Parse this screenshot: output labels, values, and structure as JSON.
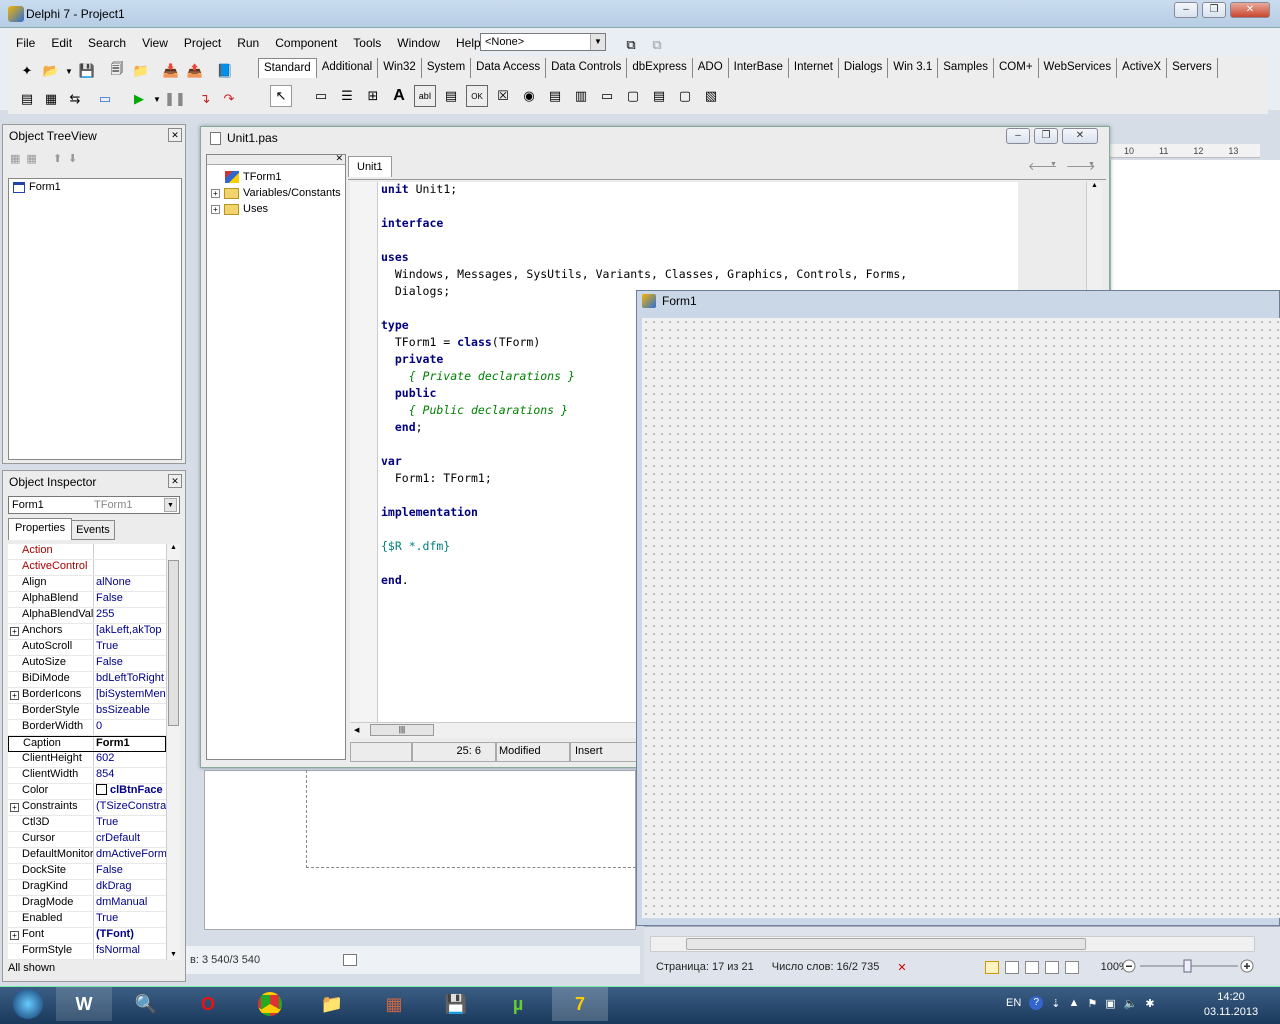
{
  "main": {
    "title": "Delphi 7 - Project1",
    "menu": [
      "File",
      "Edit",
      "Search",
      "View",
      "Project",
      "Run",
      "Component",
      "Tools",
      "Window",
      "Help"
    ],
    "config_combo": "<None>",
    "palette_tabs": [
      "Standard",
      "Additional",
      "Win32",
      "System",
      "Data Access",
      "Data Controls",
      "dbExpress",
      "ADO",
      "InterBase",
      "Internet",
      "Dialogs",
      "Win 3.1",
      "Samples",
      "COM+",
      "WebServices",
      "ActiveX",
      "Servers"
    ]
  },
  "tree_view": {
    "title": "Object TreeView",
    "items": [
      "Form1"
    ]
  },
  "inspector": {
    "title": "Object Inspector",
    "selected_object": "Form1",
    "selected_type": "TForm1",
    "tabs": [
      "Properties",
      "Events"
    ],
    "properties": [
      {
        "name": "Action",
        "value": "",
        "expandable": false,
        "red": true
      },
      {
        "name": "ActiveControl",
        "value": "",
        "expandable": false,
        "red": true
      },
      {
        "name": "Align",
        "value": "alNone",
        "expandable": false
      },
      {
        "name": "AlphaBlend",
        "value": "False",
        "expandable": false
      },
      {
        "name": "AlphaBlendValu",
        "value": "255",
        "expandable": false
      },
      {
        "name": "Anchors",
        "value": "[akLeft,akTop",
        "expandable": true
      },
      {
        "name": "AutoScroll",
        "value": "True",
        "expandable": false
      },
      {
        "name": "AutoSize",
        "value": "False",
        "expandable": false
      },
      {
        "name": "BiDiMode",
        "value": "bdLeftToRight",
        "expandable": false
      },
      {
        "name": "BorderIcons",
        "value": "[biSystemMen",
        "expandable": true
      },
      {
        "name": "BorderStyle",
        "value": "bsSizeable",
        "expandable": false
      },
      {
        "name": "BorderWidth",
        "value": "0",
        "expandable": false
      },
      {
        "name": "Caption",
        "value": "Form1",
        "expandable": false,
        "selected": true
      },
      {
        "name": "ClientHeight",
        "value": "602",
        "expandable": false
      },
      {
        "name": "ClientWidth",
        "value": "854",
        "expandable": false
      },
      {
        "name": "Color",
        "value": "clBtnFace",
        "expandable": false,
        "swatch": true
      },
      {
        "name": "Constraints",
        "value": "(TSizeConstra",
        "expandable": true
      },
      {
        "name": "Ctl3D",
        "value": "True",
        "expandable": false
      },
      {
        "name": "Cursor",
        "value": "crDefault",
        "expandable": false
      },
      {
        "name": "DefaultMonitor",
        "value": "dmActiveForm",
        "expandable": false
      },
      {
        "name": "DockSite",
        "value": "False",
        "expandable": false
      },
      {
        "name": "DragKind",
        "value": "dkDrag",
        "expandable": false
      },
      {
        "name": "DragMode",
        "value": "dmManual",
        "expandable": false
      },
      {
        "name": "Enabled",
        "value": "True",
        "expandable": false
      },
      {
        "name": "Font",
        "value": "(TFont)",
        "expandable": true,
        "bold": true
      },
      {
        "name": "FormStyle",
        "value": "fsNormal",
        "expandable": false
      }
    ],
    "footer": "All shown"
  },
  "editor": {
    "title": "Unit1.pas",
    "tab": "Unit1",
    "explorer": [
      {
        "label": "TForm1",
        "expand": false
      },
      {
        "label": "Variables/Constants",
        "expand": true
      },
      {
        "label": "Uses",
        "expand": true
      }
    ],
    "code": [
      [
        {
          "t": "unit",
          "c": "kw"
        },
        {
          "t": " Unit1;",
          "c": ""
        }
      ],
      [],
      [
        {
          "t": "interface",
          "c": "kw"
        }
      ],
      [],
      [
        {
          "t": "uses",
          "c": "kw"
        }
      ],
      [
        {
          "t": "  Windows, Messages, SysUtils, Variants, Classes, Graphics, Controls, Forms,",
          "c": ""
        }
      ],
      [
        {
          "t": "  Dialogs;",
          "c": ""
        }
      ],
      [],
      [
        {
          "t": "type",
          "c": "kw"
        }
      ],
      [
        {
          "t": "  TForm1 = ",
          "c": ""
        },
        {
          "t": "class",
          "c": "kw"
        },
        {
          "t": "(TForm)",
          "c": ""
        }
      ],
      [
        {
          "t": "  ",
          "c": ""
        },
        {
          "t": "private",
          "c": "kw"
        }
      ],
      [
        {
          "t": "    { Private declarations }",
          "c": "cm"
        }
      ],
      [
        {
          "t": "  ",
          "c": ""
        },
        {
          "t": "public",
          "c": "kw"
        }
      ],
      [
        {
          "t": "    { Public declarations }",
          "c": "cm"
        }
      ],
      [
        {
          "t": "  ",
          "c": ""
        },
        {
          "t": "end",
          "c": "kw"
        },
        {
          "t": ";",
          "c": ""
        }
      ],
      [],
      [
        {
          "t": "var",
          "c": "kw"
        }
      ],
      [
        {
          "t": "  Form1: TForm1;",
          "c": ""
        }
      ],
      [],
      [
        {
          "t": "implementation",
          "c": "kw"
        }
      ],
      [],
      [
        {
          "t": "{$R *.dfm}",
          "c": "dr"
        }
      ],
      [],
      [
        {
          "t": "end",
          "c": "kw"
        },
        {
          "t": ".",
          "c": ""
        }
      ]
    ],
    "status": {
      "position": "25:  6",
      "state": "Modified",
      "mode": "Insert"
    }
  },
  "form": {
    "title": "Form1"
  },
  "word": {
    "status_left": "в: 3 540/3 540",
    "page": "Страница: 17 из 21",
    "words": "Число слов: 16/2 735",
    "zoom": "100%",
    "ruler": [
      "10",
      "11",
      "12",
      "13"
    ]
  },
  "taskbar": {
    "lang": "EN",
    "time": "14:20",
    "date": "03.11.2013"
  },
  "colors": {
    "keyword": "#000080",
    "comment": "#008000",
    "directive": "#008080",
    "property_value": "#00008b"
  }
}
